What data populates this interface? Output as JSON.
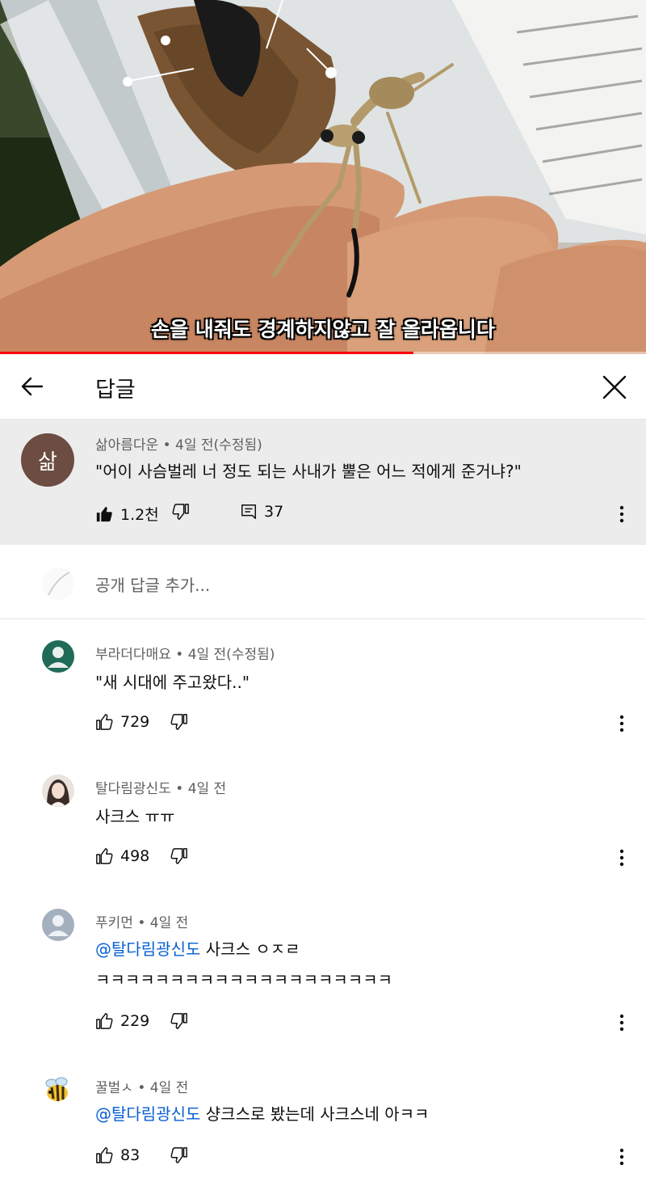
{
  "video": {
    "subtitle": "손을 내줘도 경계하지않고 잘 올라옵니다",
    "progress": 0.64
  },
  "header": {
    "back_icon": "arrow-left-icon",
    "title": "답글",
    "close_icon": "close-icon"
  },
  "parent_comment": {
    "avatar_text": "삶",
    "avatar_color": "#6d4c41",
    "author": "삶아름다운",
    "time": "4일 전(수정됨)",
    "text": "\"어이 사슴벌레 너 정도 되는 사내가 뿔은 어느 적에게 준거냐?\"",
    "likes": "1.2천",
    "replies_count": "37"
  },
  "reply_box": {
    "placeholder": "공개 답글 추가..."
  },
  "replies": [
    {
      "author": "부라더다매요",
      "time": "4일 전(수정됨)",
      "text": "\"새 시대에 주고왔다..\"",
      "likes": "729"
    },
    {
      "author": "탈다림광신도",
      "time": "4일 전",
      "text": "사크스 ㅠㅠ",
      "likes": "498"
    },
    {
      "author": "푸키먼",
      "time": "4일 전",
      "mention": "@탈다림광신도",
      "text": "사크스 ㅇㅈㄹ",
      "text2": "ㅋㅋㅋㅋㅋㅋㅋㅋㅋㅋㅋㅋㅋㅋㅋㅋㅋㅋㅋㅋ",
      "likes": "229"
    },
    {
      "author": "꿀벌ㅅ",
      "time": "4일 전",
      "mention": "@탈다림광신도",
      "text": "샹크스로 봤는데 사크스네 아ㅋㅋ",
      "likes": "83"
    }
  ],
  "colors": {
    "accent_red": "#ff0000",
    "mention_blue": "#065fd4",
    "meta_gray": "#606060",
    "parent_bg": "#ececec"
  }
}
